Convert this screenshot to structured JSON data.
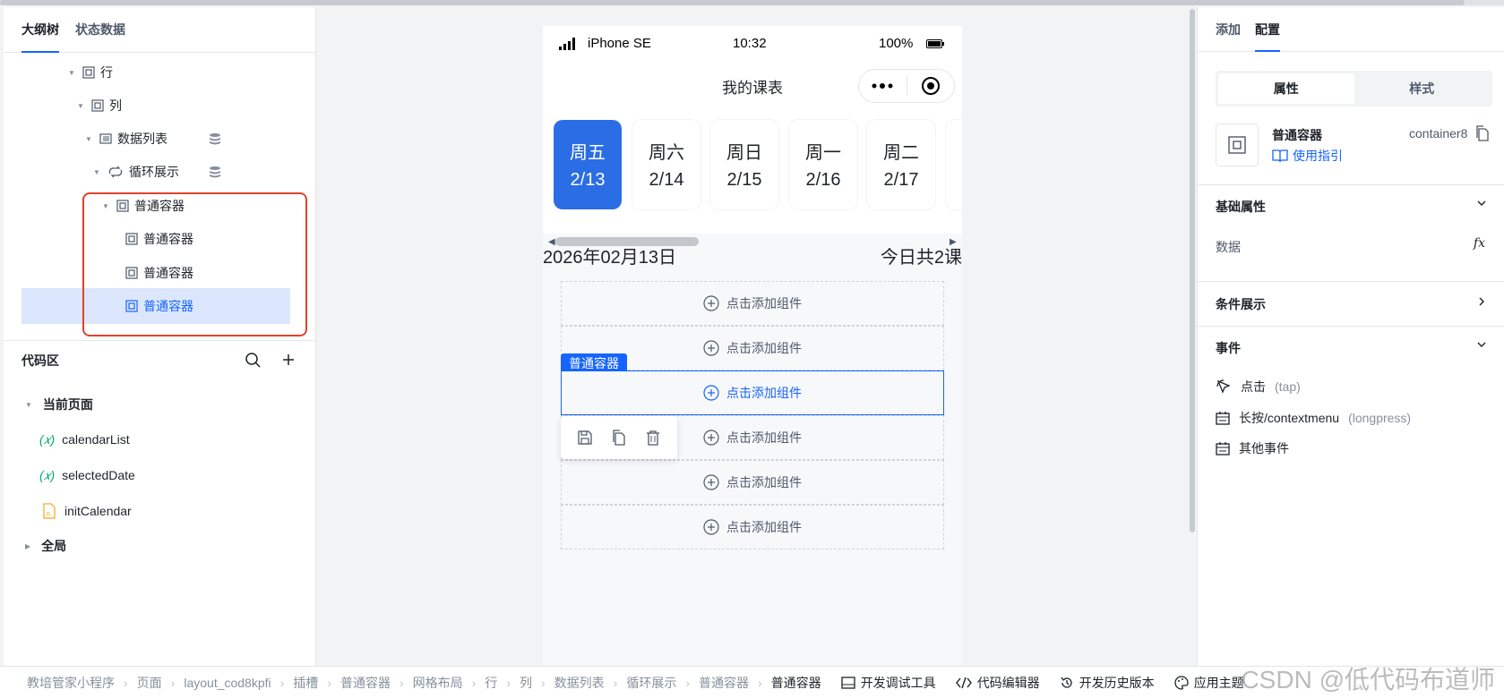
{
  "left_panel": {
    "tabs": [
      "大纲树",
      "状态数据"
    ],
    "tree": [
      {
        "label": "行"
      },
      {
        "label": "列"
      },
      {
        "label": "数据列表"
      },
      {
        "label": "循环展示"
      },
      {
        "label": "普通容器"
      },
      {
        "label": "普通容器"
      },
      {
        "label": "普通容器"
      },
      {
        "label": "普通容器"
      }
    ],
    "code_title": "代码区",
    "code_groups": {
      "current": "当前页面",
      "items": [
        "calendarList",
        "selectedDate",
        "initCalendar"
      ],
      "var_prefix": "(𝑥)",
      "global": "全局"
    }
  },
  "phone": {
    "status": {
      "device": "iPhone SE",
      "time": "10:32",
      "battery": "100%"
    },
    "nav_title": "我的课表",
    "days": [
      {
        "week": "周五",
        "date": "2/13"
      },
      {
        "week": "周六",
        "date": "2/14"
      },
      {
        "week": "周日",
        "date": "2/15"
      },
      {
        "week": "周一",
        "date": "2/16"
      },
      {
        "week": "周二",
        "date": "2/17"
      }
    ],
    "date_text": "2026年02月13日",
    "today_text": "今日共2课",
    "slot_label": "点击添加组件",
    "selected_tag": "普通容器"
  },
  "right_panel": {
    "tabs": [
      "添加",
      "配置"
    ],
    "segments": [
      "属性",
      "样式"
    ],
    "component": {
      "name": "普通容器",
      "id": "container8",
      "guide": "使用指引"
    },
    "basic": {
      "title": "基础属性",
      "data_label": "数据",
      "fx": "fx"
    },
    "condition": {
      "title": "条件展示"
    },
    "events": {
      "title": "事件",
      "items": [
        {
          "label": "点击",
          "hint": "(tap)"
        },
        {
          "label": "长按/contextmenu",
          "hint": "(longpress)"
        },
        {
          "label": "其他事件",
          "hint": ""
        }
      ]
    }
  },
  "bottom": {
    "breadcrumbs": [
      "教培管家小程序",
      "页面",
      "layout_cod8kpfi",
      "插槽",
      "普通容器",
      "网格布局",
      "行",
      "列",
      "数据列表",
      "循环展示",
      "普通容器",
      "普通容器"
    ],
    "tools": [
      "开发调试工具",
      "代码编辑器",
      "开发历史版本",
      "应用主题"
    ],
    "watermark": "CSDN @低代码布道师"
  },
  "colors": {
    "accent": "#1664ff",
    "active_day": "#2b6de4",
    "highlight": "#e0422a"
  }
}
